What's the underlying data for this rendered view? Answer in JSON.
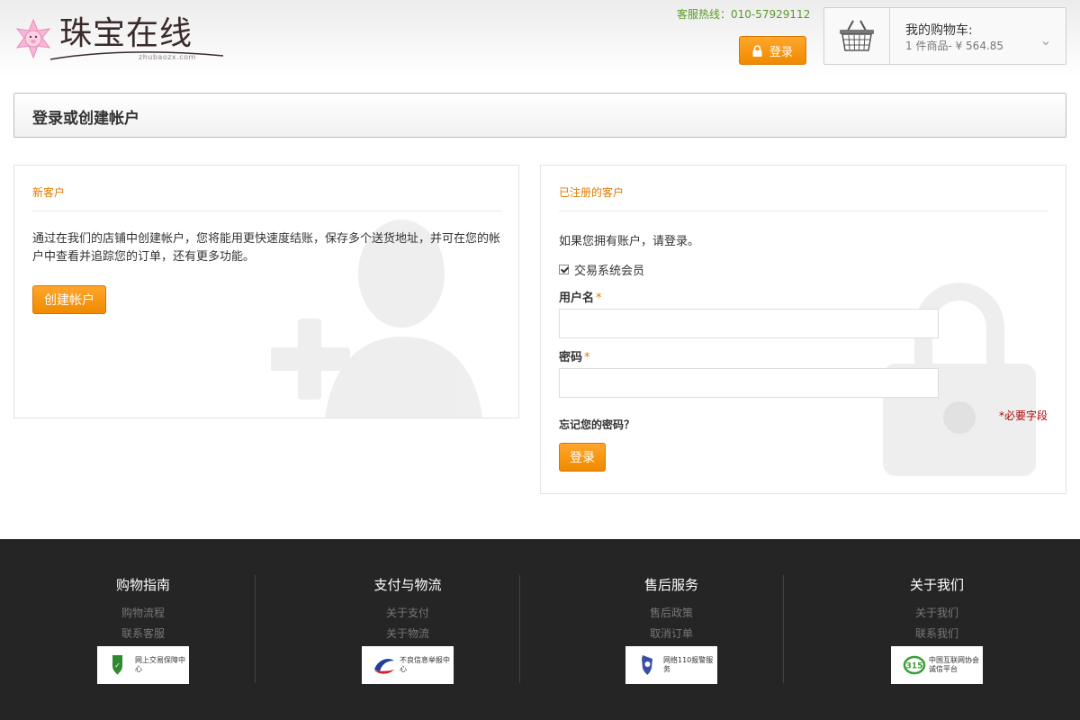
{
  "header": {
    "logo_text": "珠宝在线",
    "logo_sub": "zhubaozx.com",
    "hotline_label": "客服热线：",
    "hotline_number": "010-57929112",
    "login_button": "登录"
  },
  "cart": {
    "title": "我的购物车:",
    "summary": "1 件商品- ¥ 564.85"
  },
  "page_title": "登录或创建帐户",
  "new_customer": {
    "heading": "新客户",
    "description": "通过在我们的店铺中创建帐户，您将能用更快速度结账，保存多个送货地址，并可在您的帐户中查看并追踪您的订单，还有更多功能。",
    "create_button": "创建帐户"
  },
  "registered": {
    "heading": "已注册的客户",
    "intro": "如果您拥有账户，请登录。",
    "checkbox_label": "交易系统会员",
    "username_label": "用户名",
    "password_label": "密码",
    "required_mark": "*",
    "required_note": "*必要字段",
    "forgot": "忘记您的密码？",
    "login_button": "登录"
  },
  "footer": {
    "columns": [
      {
        "title": "购物指南",
        "links": [
          "购物流程",
          "联系客服"
        ],
        "badge": "网上交易保障中心"
      },
      {
        "title": "支付与物流",
        "links": [
          "关于支付",
          "关于物流"
        ],
        "badge": "不良信息举报中心"
      },
      {
        "title": "售后服务",
        "links": [
          "售后政策",
          "取消订单"
        ],
        "badge": "网络110报警服务"
      },
      {
        "title": "关于我们",
        "links": [
          "关于我们",
          "联系我们"
        ],
        "badge": "中国互联网协会诚信平台"
      }
    ]
  },
  "colors": {
    "accent_orange": "#f08a00",
    "hotline_green": "#5a9a2a",
    "required_red": "#b00000",
    "footer_bg": "#252525"
  }
}
